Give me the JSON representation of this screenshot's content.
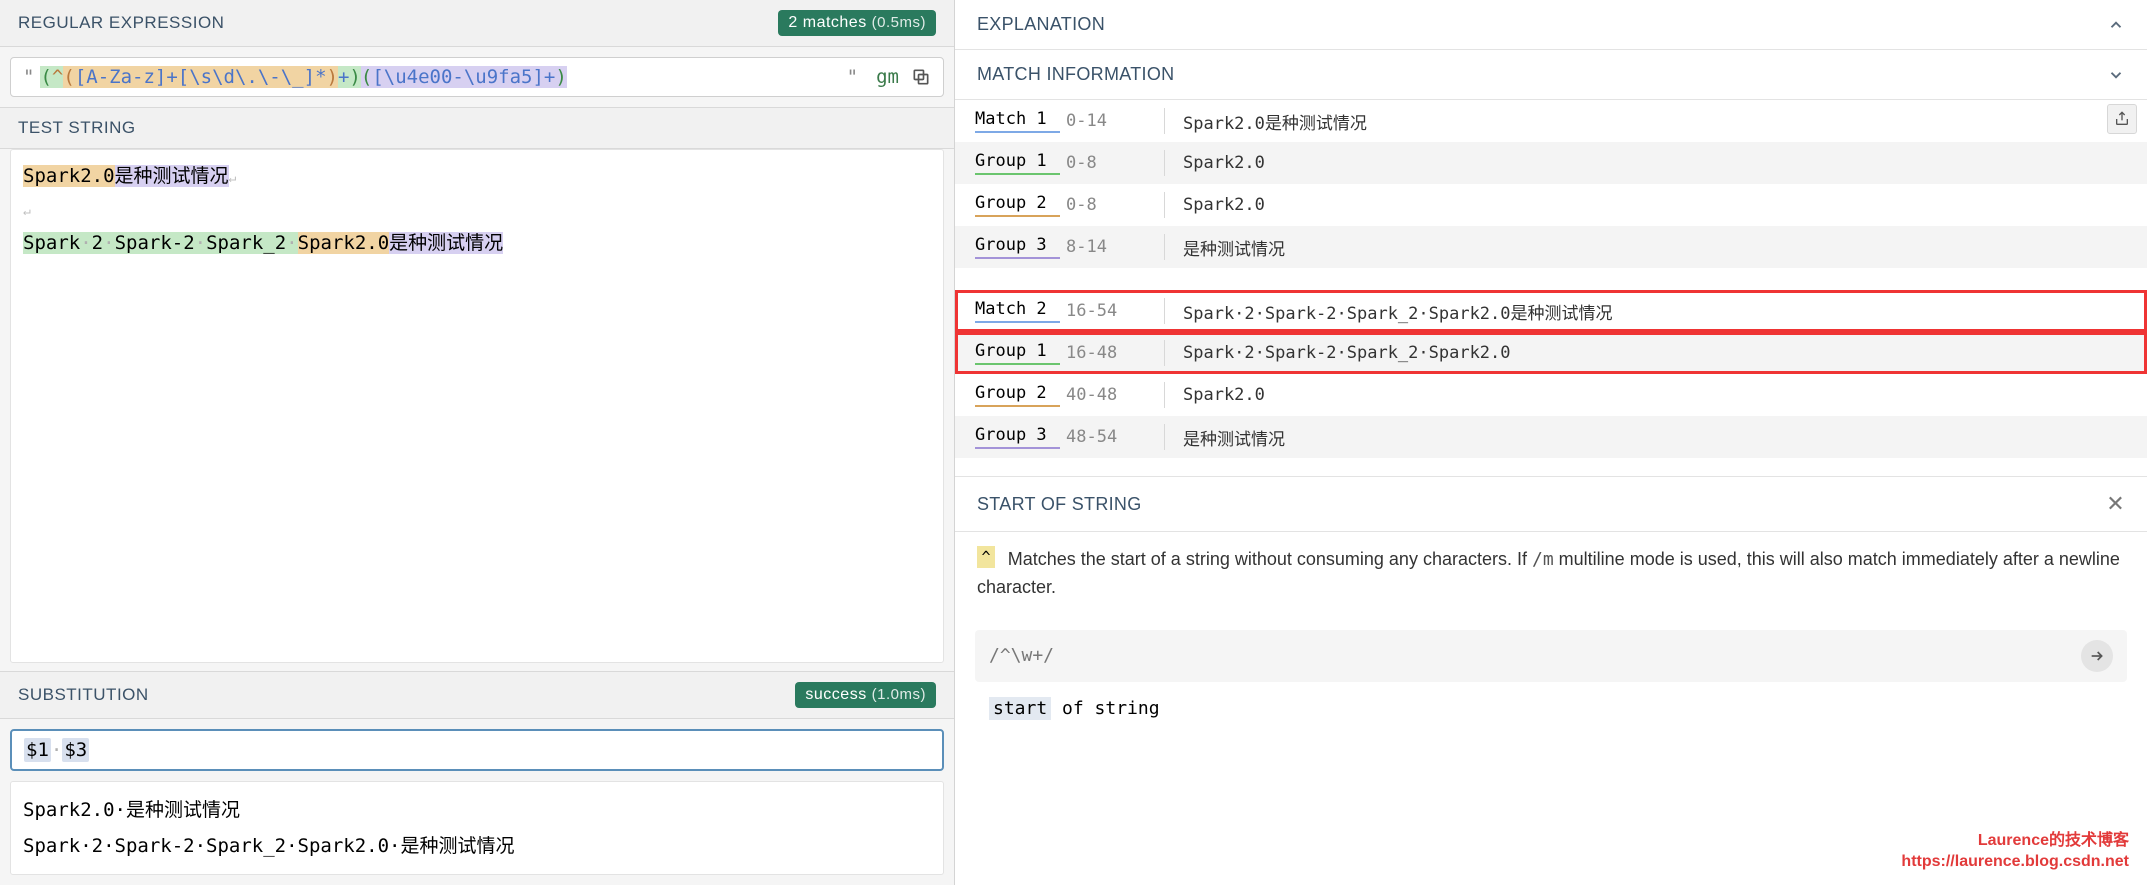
{
  "regex": {
    "header": "REGULAR EXPRESSION",
    "matches_badge": "2 matches",
    "matches_time": "(0.5ms)",
    "delimiter": "\"",
    "flags": "gm",
    "tokens": {
      "p1": "(",
      "caret": "^",
      "p2": "(",
      "cls1": "[A-Za-z]",
      "plus1": "+",
      "cls2": "[\\s\\d\\.\\-\\_]",
      "star": "*",
      "p3": ")",
      "plus2": "+",
      "p4": ")",
      "p5": "(",
      "cls3": "[\\u4e00-\\u9fa5]",
      "plus3": "+",
      "p6": ")"
    }
  },
  "test_string": {
    "header": "TEST STRING",
    "line1_a": "Spark2.0",
    "line1_b": "是种测试情况",
    "line2_a": "Spark",
    "line2_b": "2",
    "line2_c": "Spark-2",
    "line2_d": "Spark_2",
    "line2_e": "Spark2.0",
    "line2_f": "是种测试情况",
    "dot": "·"
  },
  "substitution": {
    "header": "SUBSTITUTION",
    "success": "success",
    "success_time": "(1.0ms)",
    "input_1": "$1",
    "input_2": "$3",
    "out1": "Spark2.0·是种测试情况",
    "out2": "Spark·2·Spark-2·Spark_2·Spark2.0·是种测试情况"
  },
  "explanation": {
    "header": "EXPLANATION"
  },
  "match_info": {
    "header": "MATCH INFORMATION",
    "rows": [
      {
        "label": "Match 1",
        "range": "0-14",
        "value": "Spark2.0是种测试情况",
        "ul": "blue",
        "striped": false,
        "hl": false,
        "share": true
      },
      {
        "label": "Group 1",
        "range": "0-8",
        "value": "Spark2.0",
        "ul": "green",
        "striped": true,
        "hl": false
      },
      {
        "label": "Group 2",
        "range": "0-8",
        "value": "Spark2.0",
        "ul": "orange",
        "striped": false,
        "hl": false
      },
      {
        "label": "Group 3",
        "range": "8-14",
        "value": "是种测试情况",
        "ul": "lav",
        "striped": true,
        "hl": false
      },
      {
        "label": "Match 2",
        "range": "16-54",
        "value": "Spark·2·Spark-2·Spark_2·Spark2.0是种测试情况",
        "ul": "blue",
        "striped": false,
        "hl": true,
        "gap": true
      },
      {
        "label": "Group 1",
        "range": "16-48",
        "value": "Spark·2·Spark-2·Spark_2·Spark2.0",
        "ul": "green",
        "striped": true,
        "hl": true
      },
      {
        "label": "Group 2",
        "range": "40-48",
        "value": "Spark2.0",
        "ul": "orange",
        "striped": false,
        "hl": false
      },
      {
        "label": "Group 3",
        "range": "48-54",
        "value": "是种测试情况",
        "ul": "lav",
        "striped": true,
        "hl": false
      }
    ]
  },
  "start_of_string": {
    "header": "START OF STRING",
    "caret": "^",
    "text_a": "Matches the start of a string without consuming any characters. If ",
    "text_mono": "/m",
    "text_b": " multiline mode is used, this will also match immediately after a newline character.",
    "code": "/^\\w+/",
    "result_a": "start",
    "result_b": " of string"
  },
  "watermark": {
    "line1": "Laurence的技术博客",
    "line2": "https://laurence.blog.csdn.net"
  }
}
